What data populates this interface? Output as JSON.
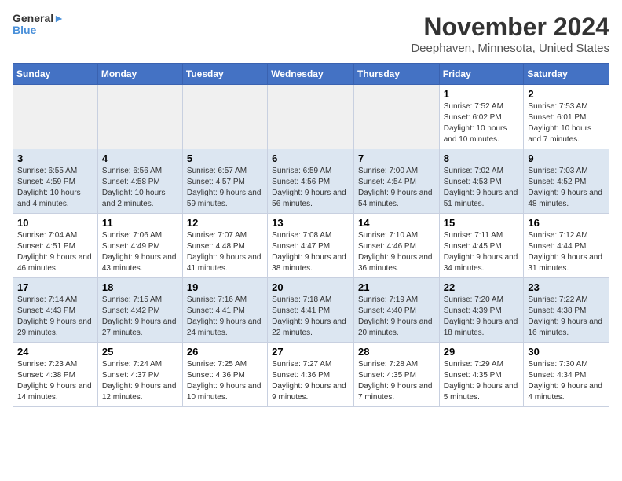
{
  "header": {
    "logo_line1": "General",
    "logo_line2": "Blue",
    "title": "November 2024",
    "subtitle": "Deephaven, Minnesota, United States"
  },
  "weekdays": [
    "Sunday",
    "Monday",
    "Tuesday",
    "Wednesday",
    "Thursday",
    "Friday",
    "Saturday"
  ],
  "weeks": [
    {
      "days": [
        {
          "num": "",
          "info": ""
        },
        {
          "num": "",
          "info": ""
        },
        {
          "num": "",
          "info": ""
        },
        {
          "num": "",
          "info": ""
        },
        {
          "num": "",
          "info": ""
        },
        {
          "num": "1",
          "info": "Sunrise: 7:52 AM\nSunset: 6:02 PM\nDaylight: 10 hours and 10 minutes."
        },
        {
          "num": "2",
          "info": "Sunrise: 7:53 AM\nSunset: 6:01 PM\nDaylight: 10 hours and 7 minutes."
        }
      ]
    },
    {
      "days": [
        {
          "num": "3",
          "info": "Sunrise: 6:55 AM\nSunset: 4:59 PM\nDaylight: 10 hours and 4 minutes."
        },
        {
          "num": "4",
          "info": "Sunrise: 6:56 AM\nSunset: 4:58 PM\nDaylight: 10 hours and 2 minutes."
        },
        {
          "num": "5",
          "info": "Sunrise: 6:57 AM\nSunset: 4:57 PM\nDaylight: 9 hours and 59 minutes."
        },
        {
          "num": "6",
          "info": "Sunrise: 6:59 AM\nSunset: 4:56 PM\nDaylight: 9 hours and 56 minutes."
        },
        {
          "num": "7",
          "info": "Sunrise: 7:00 AM\nSunset: 4:54 PM\nDaylight: 9 hours and 54 minutes."
        },
        {
          "num": "8",
          "info": "Sunrise: 7:02 AM\nSunset: 4:53 PM\nDaylight: 9 hours and 51 minutes."
        },
        {
          "num": "9",
          "info": "Sunrise: 7:03 AM\nSunset: 4:52 PM\nDaylight: 9 hours and 48 minutes."
        }
      ]
    },
    {
      "days": [
        {
          "num": "10",
          "info": "Sunrise: 7:04 AM\nSunset: 4:51 PM\nDaylight: 9 hours and 46 minutes."
        },
        {
          "num": "11",
          "info": "Sunrise: 7:06 AM\nSunset: 4:49 PM\nDaylight: 9 hours and 43 minutes."
        },
        {
          "num": "12",
          "info": "Sunrise: 7:07 AM\nSunset: 4:48 PM\nDaylight: 9 hours and 41 minutes."
        },
        {
          "num": "13",
          "info": "Sunrise: 7:08 AM\nSunset: 4:47 PM\nDaylight: 9 hours and 38 minutes."
        },
        {
          "num": "14",
          "info": "Sunrise: 7:10 AM\nSunset: 4:46 PM\nDaylight: 9 hours and 36 minutes."
        },
        {
          "num": "15",
          "info": "Sunrise: 7:11 AM\nSunset: 4:45 PM\nDaylight: 9 hours and 34 minutes."
        },
        {
          "num": "16",
          "info": "Sunrise: 7:12 AM\nSunset: 4:44 PM\nDaylight: 9 hours and 31 minutes."
        }
      ]
    },
    {
      "days": [
        {
          "num": "17",
          "info": "Sunrise: 7:14 AM\nSunset: 4:43 PM\nDaylight: 9 hours and 29 minutes."
        },
        {
          "num": "18",
          "info": "Sunrise: 7:15 AM\nSunset: 4:42 PM\nDaylight: 9 hours and 27 minutes."
        },
        {
          "num": "19",
          "info": "Sunrise: 7:16 AM\nSunset: 4:41 PM\nDaylight: 9 hours and 24 minutes."
        },
        {
          "num": "20",
          "info": "Sunrise: 7:18 AM\nSunset: 4:41 PM\nDaylight: 9 hours and 22 minutes."
        },
        {
          "num": "21",
          "info": "Sunrise: 7:19 AM\nSunset: 4:40 PM\nDaylight: 9 hours and 20 minutes."
        },
        {
          "num": "22",
          "info": "Sunrise: 7:20 AM\nSunset: 4:39 PM\nDaylight: 9 hours and 18 minutes."
        },
        {
          "num": "23",
          "info": "Sunrise: 7:22 AM\nSunset: 4:38 PM\nDaylight: 9 hours and 16 minutes."
        }
      ]
    },
    {
      "days": [
        {
          "num": "24",
          "info": "Sunrise: 7:23 AM\nSunset: 4:38 PM\nDaylight: 9 hours and 14 minutes."
        },
        {
          "num": "25",
          "info": "Sunrise: 7:24 AM\nSunset: 4:37 PM\nDaylight: 9 hours and 12 minutes."
        },
        {
          "num": "26",
          "info": "Sunrise: 7:25 AM\nSunset: 4:36 PM\nDaylight: 9 hours and 10 minutes."
        },
        {
          "num": "27",
          "info": "Sunrise: 7:27 AM\nSunset: 4:36 PM\nDaylight: 9 hours and 9 minutes."
        },
        {
          "num": "28",
          "info": "Sunrise: 7:28 AM\nSunset: 4:35 PM\nDaylight: 9 hours and 7 minutes."
        },
        {
          "num": "29",
          "info": "Sunrise: 7:29 AM\nSunset: 4:35 PM\nDaylight: 9 hours and 5 minutes."
        },
        {
          "num": "30",
          "info": "Sunrise: 7:30 AM\nSunset: 4:34 PM\nDaylight: 9 hours and 4 minutes."
        }
      ]
    }
  ],
  "row_backgrounds": [
    "#ffffff",
    "#dce6f1",
    "#ffffff",
    "#dce6f1",
    "#ffffff"
  ]
}
